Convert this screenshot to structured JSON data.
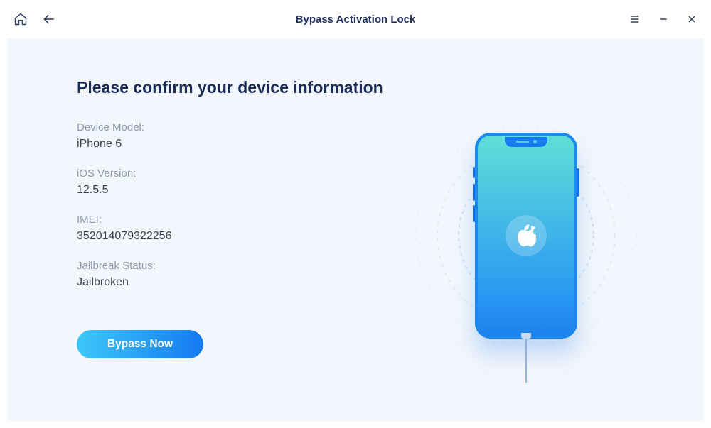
{
  "header": {
    "title": "Bypass Activation Lock"
  },
  "main": {
    "title": "Please confirm your device information",
    "fields": {
      "deviceModel": {
        "label": "Device Model:",
        "value": "iPhone 6"
      },
      "iosVersion": {
        "label": "iOS Version:",
        "value": "12.5.5"
      },
      "imei": {
        "label": "IMEI:",
        "value": "352014079322256"
      },
      "jailbreak": {
        "label": "Jailbreak Status:",
        "value": "Jailbroken"
      }
    },
    "bypassButton": "Bypass Now"
  }
}
